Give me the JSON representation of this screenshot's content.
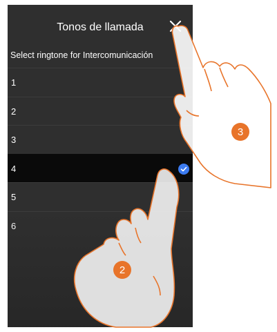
{
  "header": {
    "title": "Tonos de llamada",
    "close_icon": "close-icon"
  },
  "subtitle": "Select ringtone for Intercomunicación",
  "list": {
    "items": [
      {
        "label": "1",
        "selected": false
      },
      {
        "label": "2",
        "selected": false
      },
      {
        "label": "3",
        "selected": false
      },
      {
        "label": "4",
        "selected": true
      },
      {
        "label": "5",
        "selected": false
      },
      {
        "label": "6",
        "selected": false
      }
    ],
    "selected_icon": "check-circle-icon"
  },
  "callouts": {
    "step_2": "2",
    "step_3": "3"
  },
  "colors": {
    "screen_bg": "#2f2f2f",
    "selected_row_bg": "#0a0a0a",
    "check_color": "#3c7bf0",
    "callout_color": "#e8742a",
    "hand_outline": "#e8742a"
  }
}
